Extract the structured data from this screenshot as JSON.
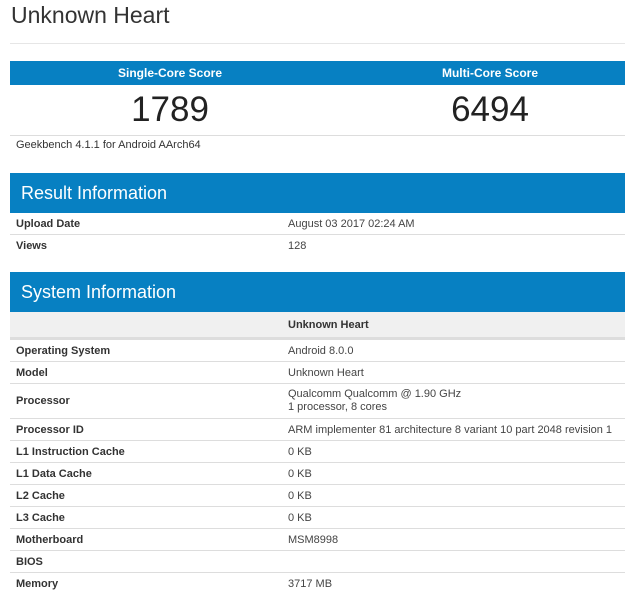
{
  "page": {
    "title": "Unknown Heart"
  },
  "scores": {
    "single_core_label": "Single-Core Score",
    "multi_core_label": "Multi-Core Score",
    "single_core_value": "1789",
    "multi_core_value": "6494",
    "platform": "Geekbench 4.1.1 for Android AArch64"
  },
  "result_info": {
    "heading": "Result Information",
    "rows": [
      {
        "key": "Upload Date",
        "value": "August 03 2017 02:24 AM"
      },
      {
        "key": "Views",
        "value": "128"
      }
    ]
  },
  "system_info": {
    "heading": "System Information",
    "column_header": "Unknown Heart",
    "rows": [
      {
        "key": "Operating System",
        "value": "Android 8.0.0"
      },
      {
        "key": "Model",
        "value": "Unknown Heart"
      },
      {
        "key": "Processor",
        "value": "Qualcomm Qualcomm @ 1.90 GHz",
        "value_line2": "1 processor, 8 cores"
      },
      {
        "key": "Processor ID",
        "value": "ARM implementer 81 architecture 8 variant 10 part 2048 revision 1"
      },
      {
        "key": "L1 Instruction Cache",
        "value": "0 KB"
      },
      {
        "key": "L1 Data Cache",
        "value": "0 KB"
      },
      {
        "key": "L2 Cache",
        "value": "0 KB"
      },
      {
        "key": "L3 Cache",
        "value": "0 KB"
      },
      {
        "key": "Motherboard",
        "value": "MSM8998"
      },
      {
        "key": "BIOS",
        "value": ""
      },
      {
        "key": "Memory",
        "value": "3717 MB"
      }
    ]
  },
  "colors": {
    "accent": "#0780c2",
    "header_row_bg": "#f0f0f0",
    "rule": "#dddddd"
  }
}
